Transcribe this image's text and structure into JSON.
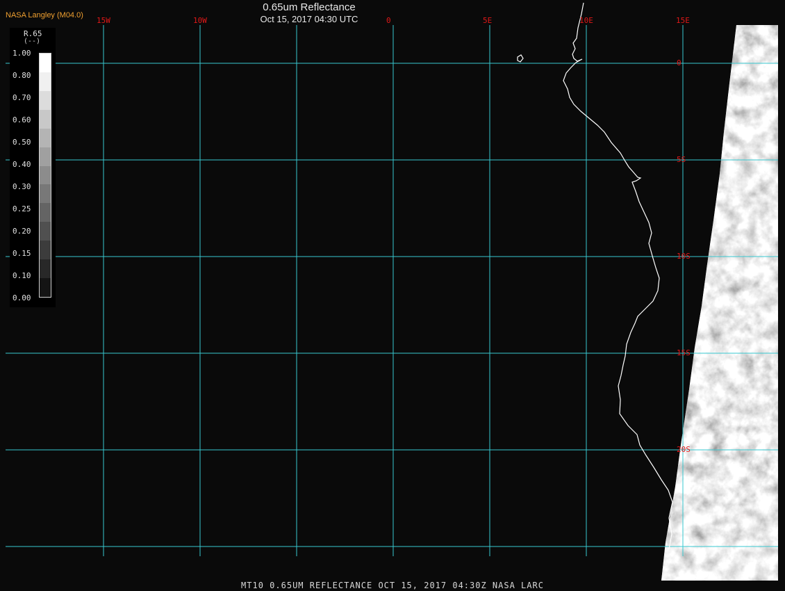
{
  "header": {
    "producer": "NASA Langley (M04.0)",
    "title": "0.65um Reflectance",
    "datetime": "Oct 15, 2017 04:30 UTC"
  },
  "footer": {
    "caption": "MT10  0.65UM REFLECTANCE   OCT 15, 2017 04:30Z   NASA LARC"
  },
  "legend": {
    "variable": "R.65",
    "unit": "(--)",
    "ticks": [
      "1.00",
      "0.80",
      "0.70",
      "0.60",
      "0.50",
      "0.40",
      "0.30",
      "0.25",
      "0.20",
      "0.15",
      "0.10",
      "0.00"
    ],
    "colors": [
      "#ffffff",
      "#f0f0f0",
      "#dcdcdc",
      "#c8c8c8",
      "#b4b4b4",
      "#a0a0a0",
      "#8c8c8c",
      "#787878",
      "#646464",
      "#505050",
      "#3c3c3c",
      "#282828",
      "#141414"
    ]
  },
  "grid": {
    "longitudes": [
      {
        "label": "15W",
        "value": -15
      },
      {
        "label": "10W",
        "value": -10
      },
      {
        "label": "",
        "value": -5
      },
      {
        "label": "0",
        "value": 0
      },
      {
        "label": "5E",
        "value": 5
      },
      {
        "label": "10E",
        "value": 10
      },
      {
        "label": "15E",
        "value": 15
      }
    ],
    "latitudes": [
      {
        "label": "0",
        "value": 0
      },
      {
        "label": "5S",
        "value": -5
      },
      {
        "label": "10S",
        "value": -10
      },
      {
        "label": "15S",
        "value": -15
      },
      {
        "label": "20S",
        "value": -20
      },
      {
        "label": "",
        "value": -25
      }
    ],
    "lon_range": [
      -20,
      20
    ],
    "lat_range": [
      2,
      -26
    ],
    "line_color": "#38c8d0",
    "label_color": "#e01818"
  },
  "coastline_color": "#ffffff",
  "ocean_color": "#0a0a0a"
}
